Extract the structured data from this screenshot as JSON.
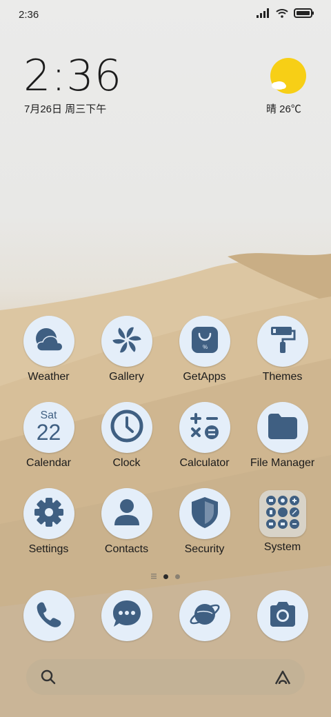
{
  "status_bar": {
    "time": "2:36",
    "icons": [
      "signal-icon",
      "wifi-icon",
      "battery-icon"
    ]
  },
  "clock_widget": {
    "time": "2:36",
    "date": "7月26日 周三下午"
  },
  "weather_widget": {
    "condition_temp": "晴 26℃",
    "icon": "sun-cloud-icon"
  },
  "apps": [
    {
      "label": "Weather",
      "icon": "weather-cloud-icon"
    },
    {
      "label": "Gallery",
      "icon": "gallery-pinwheel-icon"
    },
    {
      "label": "GetApps",
      "icon": "shopping-bag-icon"
    },
    {
      "label": "Themes",
      "icon": "paint-roller-icon"
    },
    {
      "label": "Calendar",
      "icon": "calendar-icon",
      "day": "Sat",
      "date": "22"
    },
    {
      "label": "Clock",
      "icon": "clock-icon"
    },
    {
      "label": "Calculator",
      "icon": "calculator-icon"
    },
    {
      "label": "File Manager",
      "icon": "folder-icon"
    },
    {
      "label": "Settings",
      "icon": "gear-icon"
    },
    {
      "label": "Contacts",
      "icon": "person-icon"
    },
    {
      "label": "Security",
      "icon": "shield-icon"
    },
    {
      "label": "System",
      "icon": "system-folder-icon"
    }
  ],
  "page_indicator": {
    "pages": 2,
    "current": 1
  },
  "dock": [
    {
      "name": "phone",
      "icon": "phone-icon"
    },
    {
      "name": "messages",
      "icon": "message-bubble-icon"
    },
    {
      "name": "browser",
      "icon": "planet-icon"
    },
    {
      "name": "camera",
      "icon": "camera-icon"
    }
  ],
  "colors": {
    "icon_bg": "#e4eef9",
    "icon_fg": "#3f5f82",
    "sun": "#f7cf16"
  }
}
